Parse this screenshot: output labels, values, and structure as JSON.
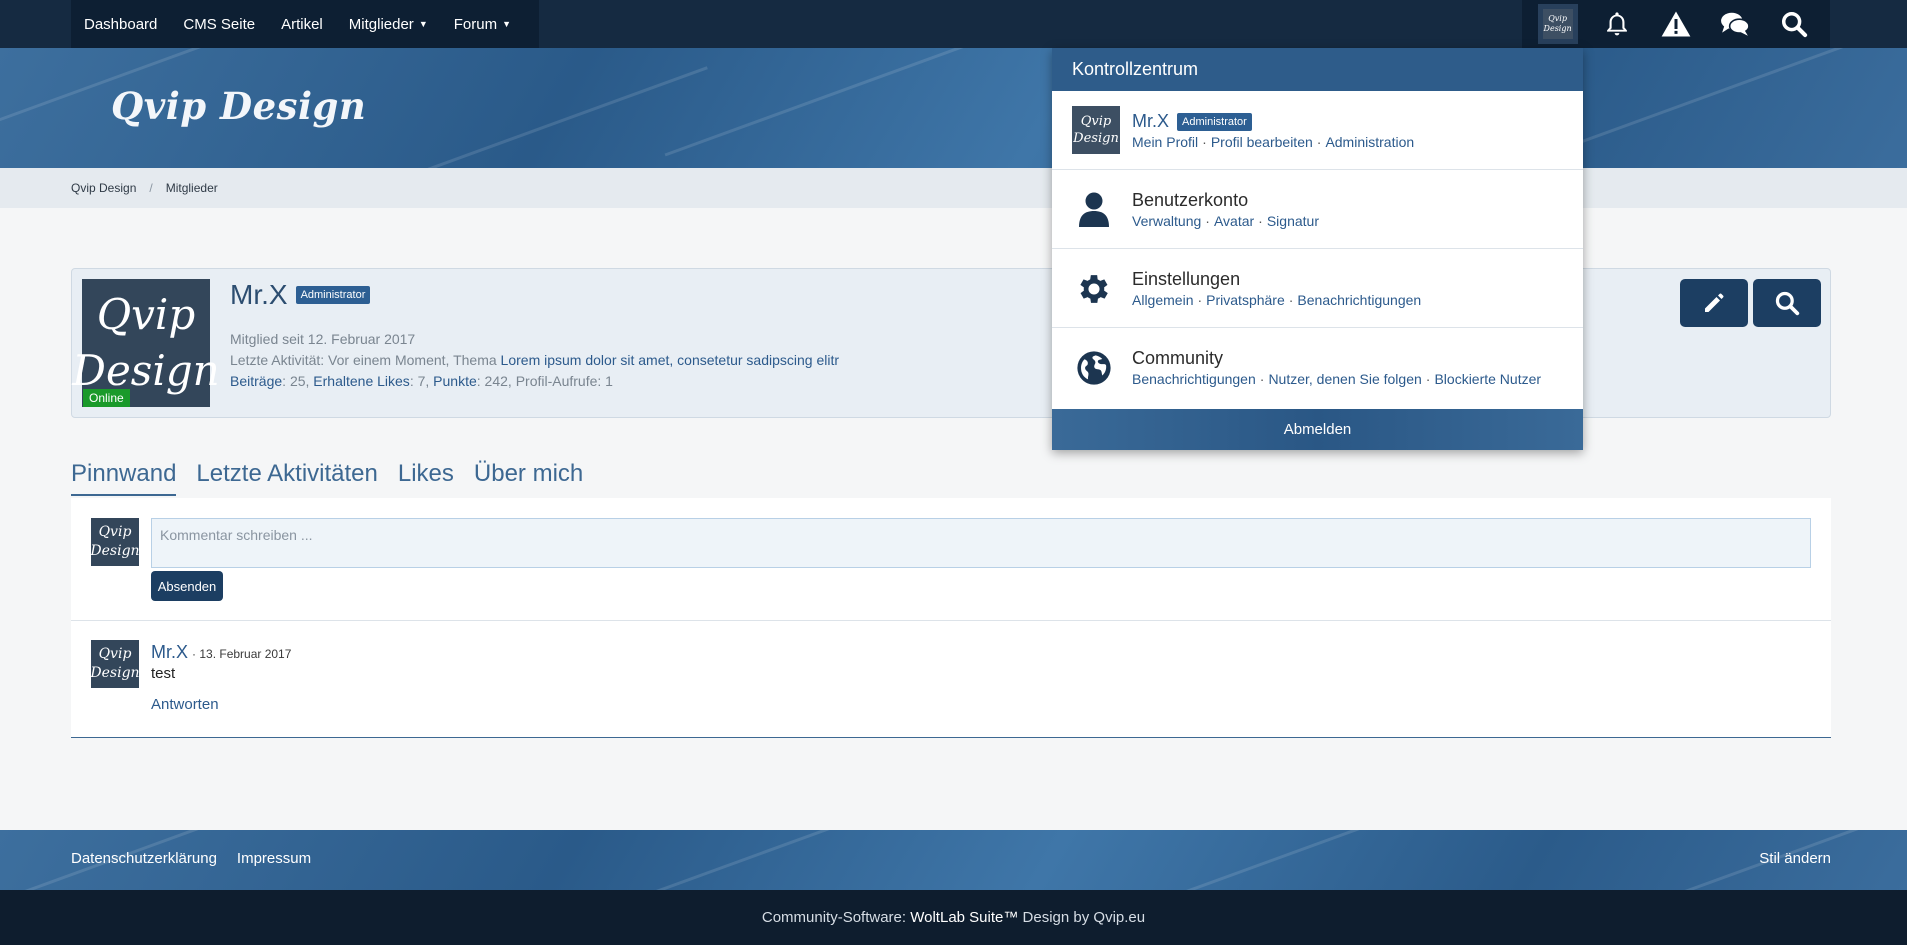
{
  "topnav": {
    "items": [
      {
        "label": "Dashboard"
      },
      {
        "label": "CMS Seite"
      },
      {
        "label": "Artikel"
      },
      {
        "label": "Mitglieder",
        "dropdown": true
      },
      {
        "label": "Forum",
        "dropdown": true
      }
    ],
    "icons": [
      "user-avatar-icon",
      "bell-icon",
      "warning-icon",
      "chat-icon",
      "search-icon"
    ],
    "avatar_text": [
      "Qvip",
      "Design"
    ]
  },
  "header": {
    "brand": "Qvip Design"
  },
  "breadcrumb": {
    "items": [
      "Qvip Design",
      "Mitglieder"
    ],
    "separator": "/"
  },
  "profile": {
    "avatar_text": [
      "Qvip",
      "Design"
    ],
    "online": "Online",
    "name": "Mr.X",
    "badge": "Administrator",
    "member_since": "Mitglied seit 12. Februar 2017",
    "last_activity_prefix": "Letzte Aktivität: Vor einem Moment,",
    "last_activity_thema": "Thema",
    "last_activity_link": "Lorem ipsum dolor sit amet, consetetur sadipscing elitr",
    "stats": [
      {
        "label": "Beiträge",
        "value": "25"
      },
      {
        "label": "Erhaltene Likes",
        "value": "7"
      },
      {
        "label": "Punkte",
        "value": "242"
      },
      {
        "label": "Profil-Aufrufe",
        "value": "1"
      }
    ]
  },
  "tabs": [
    {
      "label": "Pinnwand",
      "active": true
    },
    {
      "label": "Letzte Aktivitäten"
    },
    {
      "label": "Likes"
    },
    {
      "label": "Über mich"
    }
  ],
  "comment": {
    "placeholder": "Kommentar schreiben ...",
    "send_label": "Absenden"
  },
  "post": {
    "author": "Mr.X",
    "date": "· 13. Februar 2017",
    "text": "test",
    "reply": "Antworten"
  },
  "footer": {
    "links": [
      "Datenschutzerklärung",
      "Impressum"
    ],
    "style_change": "Stil ändern",
    "copyright_prefix": "Community-Software: ",
    "copyright_product": "WoltLab Suite™",
    "copyright_design": " Design by Qvip.eu"
  },
  "dropdown": {
    "title": "Kontrollzentrum",
    "user": {
      "name": "Mr.X",
      "badge": "Administrator",
      "links": [
        "Mein Profil",
        "Profil bearbeiten",
        "Administration"
      ]
    },
    "sections": [
      {
        "title": "Benutzerkonto",
        "icon": "user-icon",
        "links": [
          "Verwaltung",
          "Avatar",
          "Signatur"
        ]
      },
      {
        "title": "Einstellungen",
        "icon": "gear-icon",
        "links": [
          "Allgemein",
          "Privatsphäre",
          "Benachrichtigungen"
        ]
      },
      {
        "title": "Community",
        "icon": "globe-icon",
        "links": [
          "Benachrichtigungen",
          "Nutzer, denen Sie folgen",
          "Blockierte Nutzer"
        ]
      }
    ],
    "logout": "Abmelden"
  },
  "colors": {
    "topbar": "#152a41",
    "accent": "#2e5c8a",
    "badge": "#2d5f93",
    "online": "#1a9a2a",
    "button": "#1c3e62"
  }
}
